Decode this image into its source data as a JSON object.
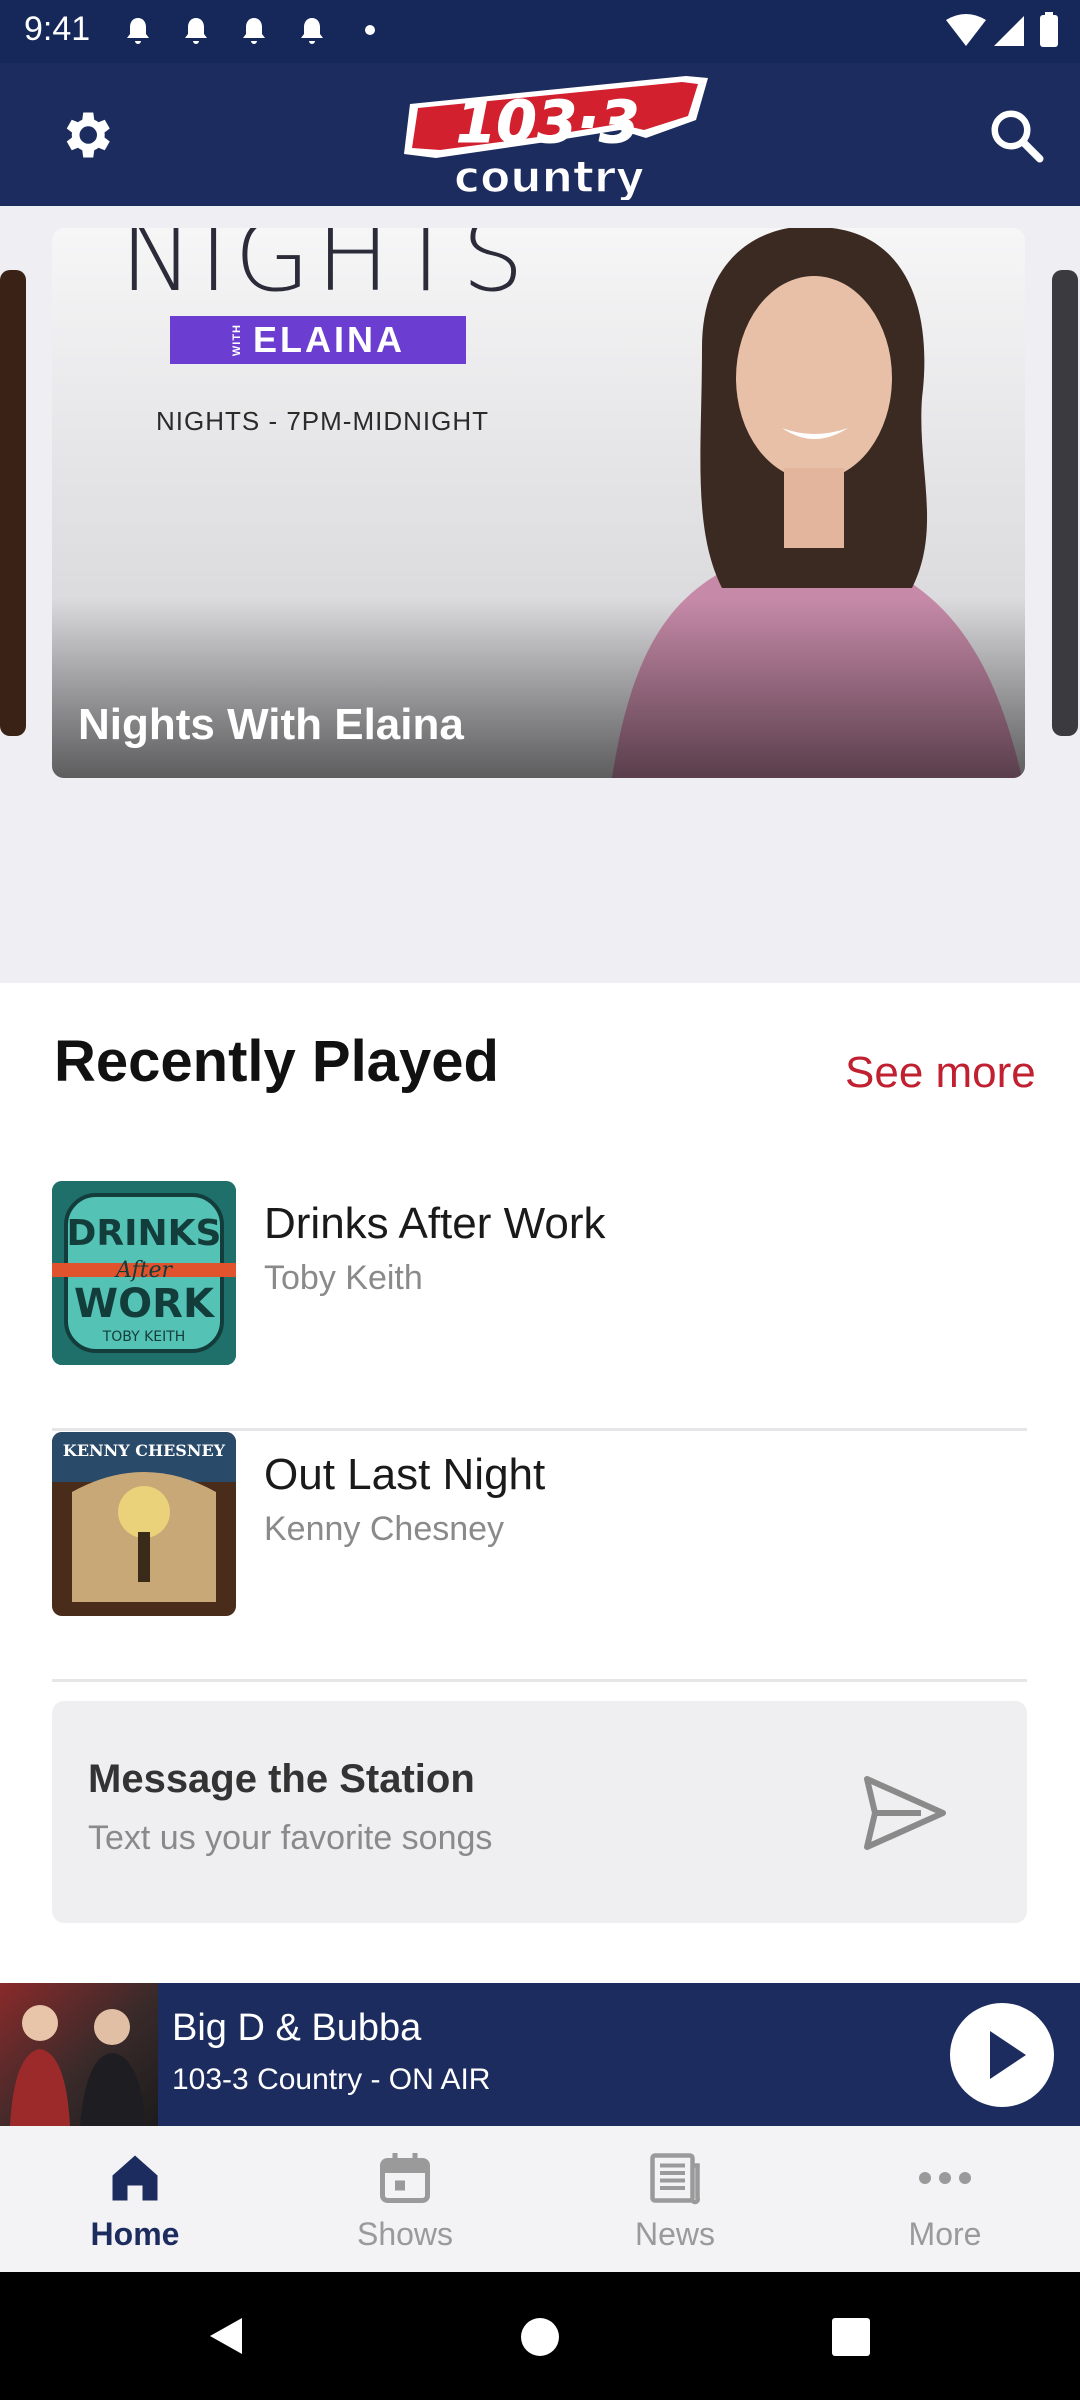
{
  "status_bar": {
    "time": "9:41"
  },
  "header": {
    "logo_number": "103·3",
    "logo_word": "country"
  },
  "hero": {
    "card_title": "Nights With Elaina",
    "graphic_title": "NIGHTS",
    "graphic_with": "WITH",
    "graphic_name": "ELAINA",
    "graphic_time": "NIGHTS - 7PM-MIDNIGHT"
  },
  "recently_played": {
    "title": "Recently Played",
    "see_more": "See more",
    "songs": [
      {
        "title": "Drinks After Work",
        "artist": "Toby Keith",
        "art_text": [
          "DRINKS",
          "After",
          "WORK",
          "TOBY KEITH"
        ]
      },
      {
        "title": "Out Last Night",
        "artist": "Kenny Chesney",
        "art_text": [
          "KENNY CHESNEY"
        ]
      }
    ]
  },
  "message_station": {
    "title": "Message the Station",
    "subtitle": "Text us your favorite songs"
  },
  "now_playing": {
    "title": "Big D & Bubba",
    "subtitle": "103-3 Country - ON AIR"
  },
  "bottom_nav": {
    "items": [
      {
        "label": "Home",
        "icon": "home-icon",
        "active": true
      },
      {
        "label": "Shows",
        "icon": "calendar-icon",
        "active": false
      },
      {
        "label": "News",
        "icon": "newspaper-icon",
        "active": false
      },
      {
        "label": "More",
        "icon": "more-dots-icon",
        "active": false
      }
    ]
  },
  "colors": {
    "navy": "#1c2c5e",
    "accent_red": "#c0202f",
    "purple": "#6b3ed1"
  }
}
